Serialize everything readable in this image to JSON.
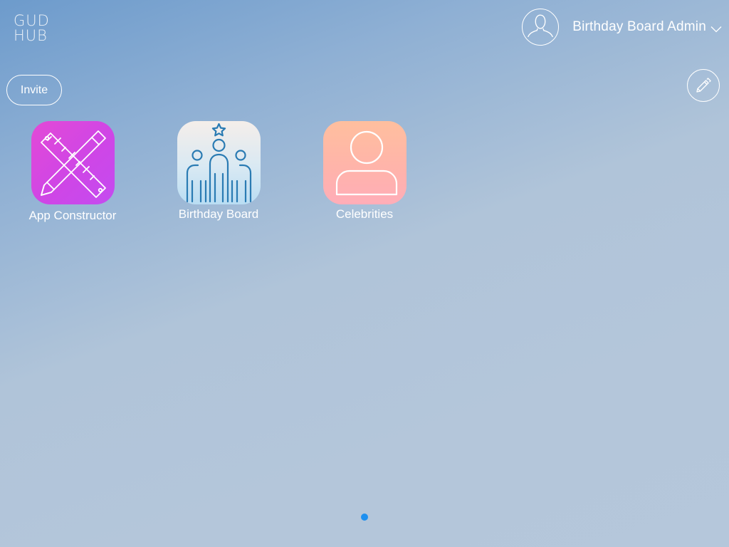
{
  "logo": {
    "line1": "GUD",
    "line2": "HUB"
  },
  "user": {
    "name": "Birthday Board Admin",
    "avatar_icon": "user-avatar-icon",
    "dropdown_icon": "chevron-down-icon"
  },
  "toolbar": {
    "invite_label": "Invite",
    "edit_icon": "pencil-icon"
  },
  "apps": [
    {
      "label": "App Constructor",
      "icon": "pencil-ruler-icon",
      "colors": [
        "#e34ad6",
        "#c44bf0"
      ]
    },
    {
      "label": "Birthday Board",
      "icon": "team-star-icon",
      "colors": [
        "#f5eeea",
        "#b9ddf3"
      ]
    },
    {
      "label": "Celebrities",
      "icon": "person-icon",
      "colors": [
        "#ffbf9e",
        "#ffadb8"
      ]
    }
  ],
  "pagination": {
    "pages": 1,
    "current": 1,
    "active_color": "#1e90f0"
  }
}
